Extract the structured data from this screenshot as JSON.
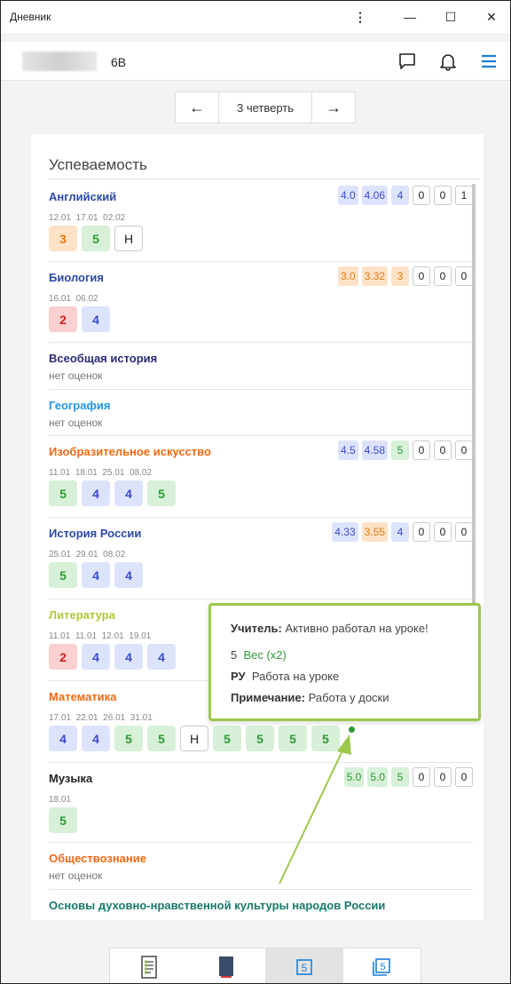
{
  "window": {
    "title": "Дневник",
    "kebab": "⋮",
    "minimize": "—",
    "maximize": "☐",
    "close": "✕"
  },
  "header": {
    "class_name": "6В"
  },
  "quarter": {
    "prev": "←",
    "label": "3 четверть",
    "next": "→"
  },
  "card": {
    "title": "Успеваемость"
  },
  "subjects": [
    {
      "name": "Английский",
      "color": "#2a48a8",
      "stats": [
        {
          "v": "4.0",
          "c": "blue"
        },
        {
          "v": "4.06",
          "c": "blue"
        },
        {
          "v": "4",
          "c": "blue"
        },
        {
          "v": "0",
          "c": "cnt"
        },
        {
          "v": "0",
          "c": "cnt"
        },
        {
          "v": "1",
          "c": "cnt"
        }
      ],
      "dates": "12.01  17.01  02.02",
      "grades": [
        {
          "v": "3",
          "c": "g3"
        },
        {
          "v": "5",
          "c": "g5"
        },
        {
          "v": "Н",
          "c": "gN"
        }
      ]
    },
    {
      "name": "Биология",
      "color": "#2a48a8",
      "stats": [
        {
          "v": "3.0",
          "c": "orange"
        },
        {
          "v": "3.32",
          "c": "orange"
        },
        {
          "v": "3",
          "c": "orange"
        },
        {
          "v": "0",
          "c": "cnt"
        },
        {
          "v": "0",
          "c": "cnt"
        },
        {
          "v": "0",
          "c": "cnt"
        }
      ],
      "dates": "16.01  06.02",
      "grades": [
        {
          "v": "2",
          "c": "g2"
        },
        {
          "v": "4",
          "c": "g4"
        }
      ]
    },
    {
      "name": "Всеобщая история",
      "color": "#2a2a78",
      "no_grades": "нет оценок"
    },
    {
      "name": "География",
      "color": "#2196e6",
      "no_grades": "нет оценок"
    },
    {
      "name": "Изобразительное искусство",
      "color": "#f06a14",
      "stats": [
        {
          "v": "4.5",
          "c": "blue"
        },
        {
          "v": "4.58",
          "c": "blue"
        },
        {
          "v": "5",
          "c": "green"
        },
        {
          "v": "0",
          "c": "cnt"
        },
        {
          "v": "0",
          "c": "cnt"
        },
        {
          "v": "0",
          "c": "cnt"
        }
      ],
      "dates": "11.01  18.01  25.01  08.02",
      "grades": [
        {
          "v": "5",
          "c": "g5"
        },
        {
          "v": "4",
          "c": "g4"
        },
        {
          "v": "4",
          "c": "g4"
        },
        {
          "v": "5",
          "c": "g5"
        }
      ]
    },
    {
      "name": "История России",
      "color": "#2a48a8",
      "stats": [
        {
          "v": "4.33",
          "c": "blue"
        },
        {
          "v": "3.55",
          "c": "orange"
        },
        {
          "v": "4",
          "c": "blue"
        },
        {
          "v": "0",
          "c": "cnt"
        },
        {
          "v": "0",
          "c": "cnt"
        },
        {
          "v": "0",
          "c": "cnt"
        }
      ],
      "dates": "25.01  29.01  08.02",
      "grades": [
        {
          "v": "5",
          "c": "g5"
        },
        {
          "v": "4",
          "c": "g4"
        },
        {
          "v": "4",
          "c": "g4"
        }
      ]
    },
    {
      "name": "Литература",
      "color": "#b7c436",
      "dates": "11.01  11.01  12.01  19.01",
      "grades": [
        {
          "v": "2",
          "c": "g2"
        },
        {
          "v": "4",
          "c": "g4"
        },
        {
          "v": "4",
          "c": "g4"
        },
        {
          "v": "4",
          "c": "g4"
        }
      ]
    },
    {
      "name": "Математика",
      "color": "#f06a14",
      "dates": "17.01  22.01  26.01  31.01",
      "grades": [
        {
          "v": "4",
          "c": "g4"
        },
        {
          "v": "4",
          "c": "g4"
        },
        {
          "v": "5",
          "c": "g5"
        },
        {
          "v": "5",
          "c": "g5"
        },
        {
          "v": "Н",
          "c": "gN"
        },
        {
          "v": "5",
          "c": "g5"
        },
        {
          "v": "5",
          "c": "g5"
        },
        {
          "v": "5",
          "c": "g5"
        },
        {
          "v": "5",
          "c": "g5"
        }
      ]
    },
    {
      "name": "Музыка",
      "color": "#222222",
      "stats": [
        {
          "v": "5.0",
          "c": "green"
        },
        {
          "v": "5.0",
          "c": "green"
        },
        {
          "v": "5",
          "c": "green"
        },
        {
          "v": "0",
          "c": "cnt"
        },
        {
          "v": "0",
          "c": "cnt"
        },
        {
          "v": "0",
          "c": "cnt"
        }
      ],
      "dates": "18.01",
      "grades": [
        {
          "v": "5",
          "c": "g5"
        }
      ]
    },
    {
      "name": "Обществознание",
      "color": "#f06a14",
      "no_grades": "нет оценок"
    },
    {
      "name": "Основы духовно-нравственной культуры народов России",
      "color": "#177a6a",
      "no_grades": "нет оценок"
    }
  ],
  "tooltip": {
    "teacher_label": "Учитель:",
    "teacher_text": "Активно работал на уроке!",
    "grade": "5",
    "weight": "Вес (x2)",
    "type_label": "РУ",
    "type_text": "Работа на уроке",
    "note_label": "Примечание:",
    "note_text": "Работа у доски"
  },
  "tabs": [
    {
      "name": "tab-diary",
      "icon": "diary-icon"
    },
    {
      "name": "tab-book",
      "icon": "book-icon"
    },
    {
      "name": "tab-grades",
      "icon": "grade-icon",
      "active": true
    },
    {
      "name": "tab-final-grades",
      "icon": "final-grades-icon"
    }
  ]
}
